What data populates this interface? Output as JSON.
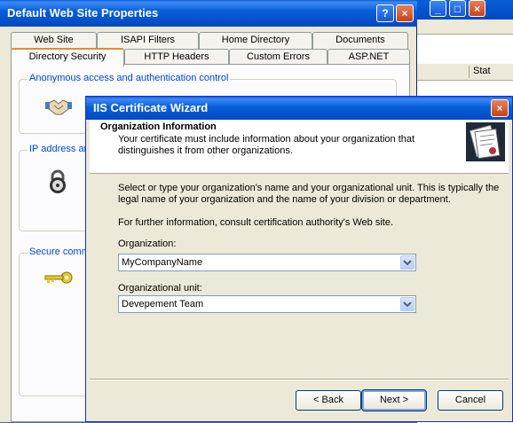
{
  "background_window": {
    "column_header": "Stat"
  },
  "properties_dialog": {
    "title": "Default Web Site Properties",
    "tabs_row1": [
      "Web Site",
      "ISAPI Filters",
      "Home Directory",
      "Documents"
    ],
    "tabs_row2": [
      "Directory Security",
      "HTTP Headers",
      "Custom Errors",
      "ASP.NET"
    ],
    "active_tab": "Directory Security",
    "groups": {
      "anonymous": "Anonymous access and authentication control",
      "ip": "IP address an",
      "secure": "Secure comm"
    }
  },
  "wizard": {
    "title": "IIS Certificate Wizard",
    "header_title": "Organization Information",
    "header_desc_line1": "Your certificate must include information about your organization that",
    "header_desc_line2": "distinguishes it from other organizations.",
    "instructions_line1": "Select or type your organization's name and your organizational unit. This is typically the",
    "instructions_line2": "legal name of your organization and the name of your division or department.",
    "info": "For further information, consult certification authority's Web site.",
    "organization_label": "Organization:",
    "organization_value": "MyCompanyName",
    "unit_label": "Organizational unit:",
    "unit_value": "Devepement Team",
    "back_label": "< Back",
    "next_label": "Next >",
    "cancel_label": "Cancel"
  },
  "colors": {
    "titlebar": "#0a5fd8",
    "dialog_bg": "#ece9d8",
    "group_title": "#0046d5"
  }
}
